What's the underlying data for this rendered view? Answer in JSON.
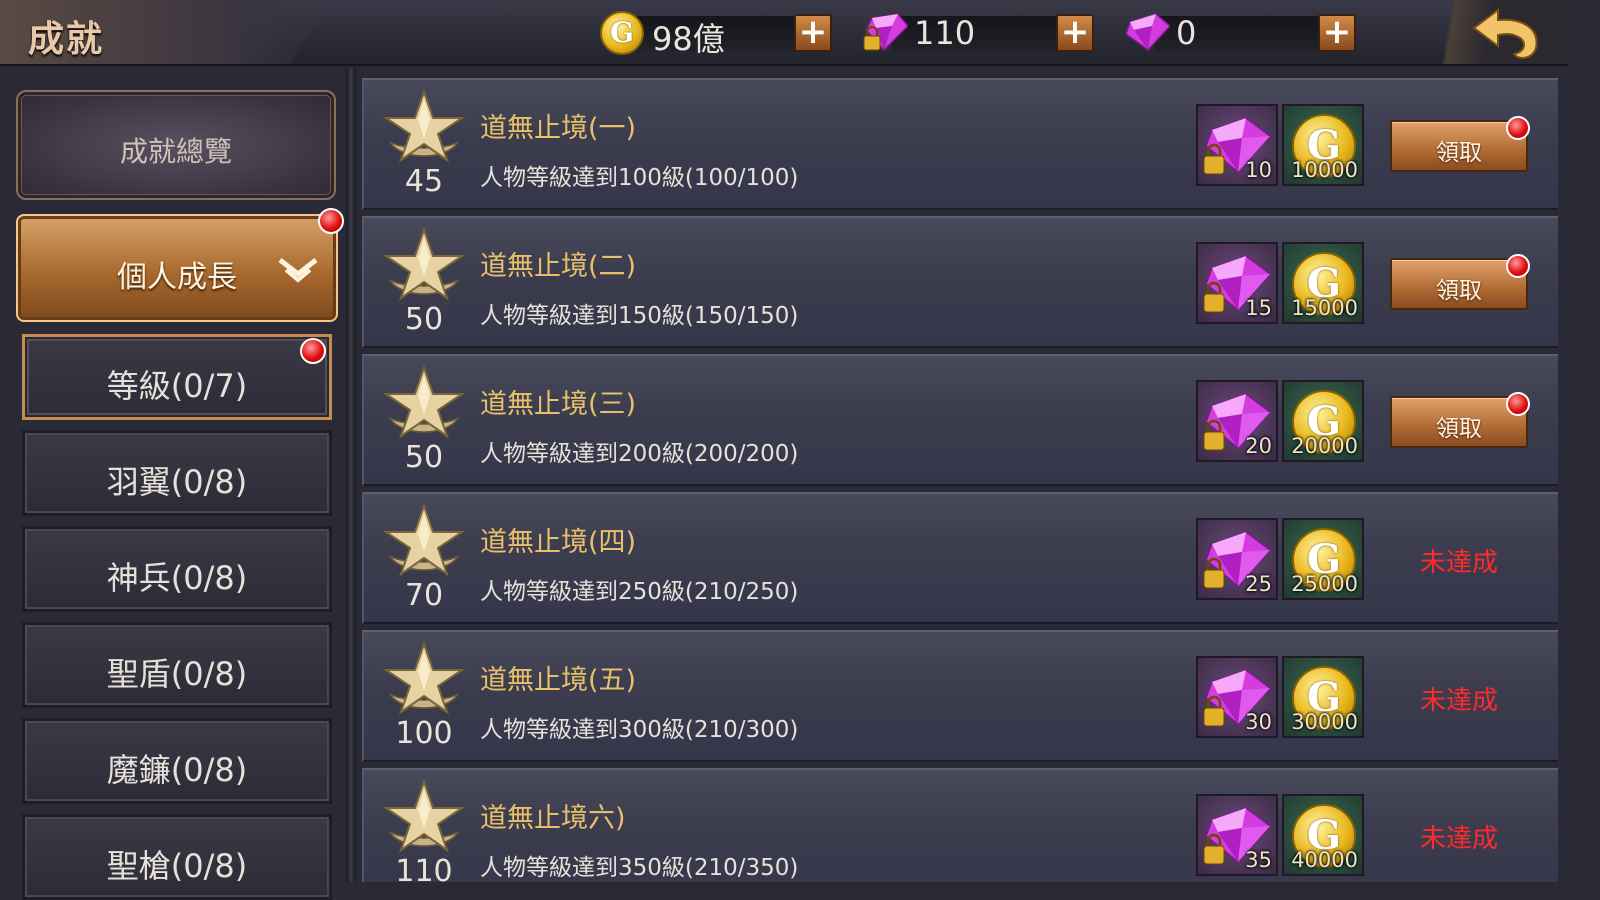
{
  "header": {
    "title": "成就",
    "gold": "98億",
    "locked_gems": "110",
    "gems": "0"
  },
  "sidebar": {
    "overview": "成就總覽",
    "growth": "個人成長",
    "categories": [
      {
        "label": "等級(0/7)"
      },
      {
        "label": "羽翼(0/8)"
      },
      {
        "label": "神兵(0/8)"
      },
      {
        "label": "聖盾(0/8)"
      },
      {
        "label": "魔鐮(0/8)"
      },
      {
        "label": "聖槍(0/8)"
      }
    ]
  },
  "achievements": [
    {
      "points": "45",
      "name": "道無止境(一)",
      "desc": "人物等級達到100級(100/100)",
      "gem_reward": "10",
      "gold_reward": "10000",
      "status": "領取"
    },
    {
      "points": "50",
      "name": "道無止境(二)",
      "desc": "人物等級達到150級(150/150)",
      "gem_reward": "15",
      "gold_reward": "15000",
      "status": "領取"
    },
    {
      "points": "50",
      "name": "道無止境(三)",
      "desc": "人物等級達到200級(200/200)",
      "gem_reward": "20",
      "gold_reward": "20000",
      "status": "領取"
    },
    {
      "points": "70",
      "name": "道無止境(四)",
      "desc": "人物等級達到250級(210/250)",
      "gem_reward": "25",
      "gold_reward": "25000",
      "status": "未達成"
    },
    {
      "points": "100",
      "name": "道無止境(五)",
      "desc": "人物等級達到300級(210/300)",
      "gem_reward": "30",
      "gold_reward": "30000",
      "status": "未達成"
    },
    {
      "points": "110",
      "name": "道無止境六)",
      "desc": "人物等級達到350級(210/350)",
      "gem_reward": "35",
      "gold_reward": "40000",
      "status": "未達成"
    }
  ],
  "icons": {
    "coin": "G",
    "plus": "+"
  }
}
